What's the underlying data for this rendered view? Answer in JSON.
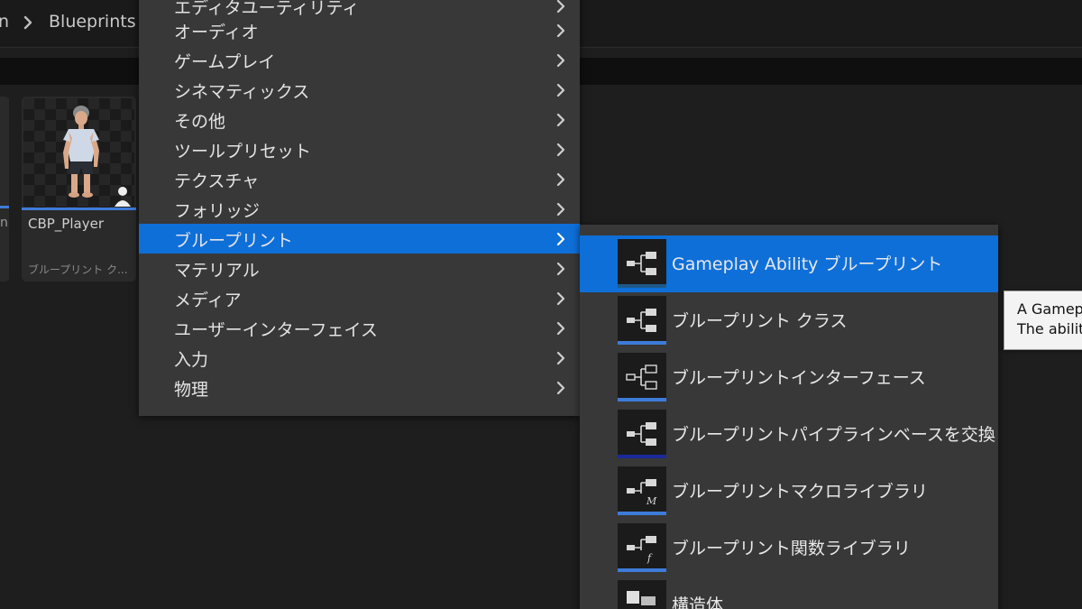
{
  "breadcrumb": {
    "partial_prev": "n",
    "current": "Blueprints"
  },
  "asset": {
    "partial_prev_hint": "n",
    "name": "CBP_Player",
    "type": "ブループリント ク..."
  },
  "menu": {
    "items": [
      {
        "label": "エディタユーティリティ"
      },
      {
        "label": "オーディオ"
      },
      {
        "label": "ゲームプレイ"
      },
      {
        "label": "シネマティックス"
      },
      {
        "label": "その他"
      },
      {
        "label": "ツールプリセット"
      },
      {
        "label": "テクスチャ"
      },
      {
        "label": "フォリッジ"
      },
      {
        "label": "ブループリント"
      },
      {
        "label": "マテリアル"
      },
      {
        "label": "メディア"
      },
      {
        "label": "ユーザーインターフェイス"
      },
      {
        "label": "入力"
      },
      {
        "label": "物理"
      }
    ],
    "active_index": 8
  },
  "submenu": {
    "items": [
      {
        "label": "Gameplay Ability ブループリント",
        "icon": "blueprint-node-icon",
        "bar_color": "#1e5a8a"
      },
      {
        "label": "ブループリント クラス",
        "icon": "blueprint-node-icon",
        "bar_color": "#3d7bd8"
      },
      {
        "label": "ブループリントインターフェース",
        "icon": "blueprint-interface-icon",
        "bar_color": "#3d7bd8"
      },
      {
        "label": "ブループリントパイプラインベースを交換",
        "icon": "blueprint-node-icon",
        "bar_color": "#1a2a9a"
      },
      {
        "label": "ブループリントマクロライブラリ",
        "icon": "blueprint-macro-icon",
        "bar_color": "#3d7bd8"
      },
      {
        "label": "ブループリント関数ライブラリ",
        "icon": "blueprint-function-icon",
        "bar_color": "#3d7bd8"
      },
      {
        "label": "構造体",
        "icon": "struct-icon",
        "bar_color": "#3d7bd8"
      }
    ],
    "active_index": 0
  },
  "tooltip": {
    "line1": "A Gameplay Ability Blueprint",
    "line2": "The ability"
  },
  "colors": {
    "accent": "#0e6fd8",
    "menu_bg": "#383838",
    "asset_bar": "#3d7bd8"
  }
}
